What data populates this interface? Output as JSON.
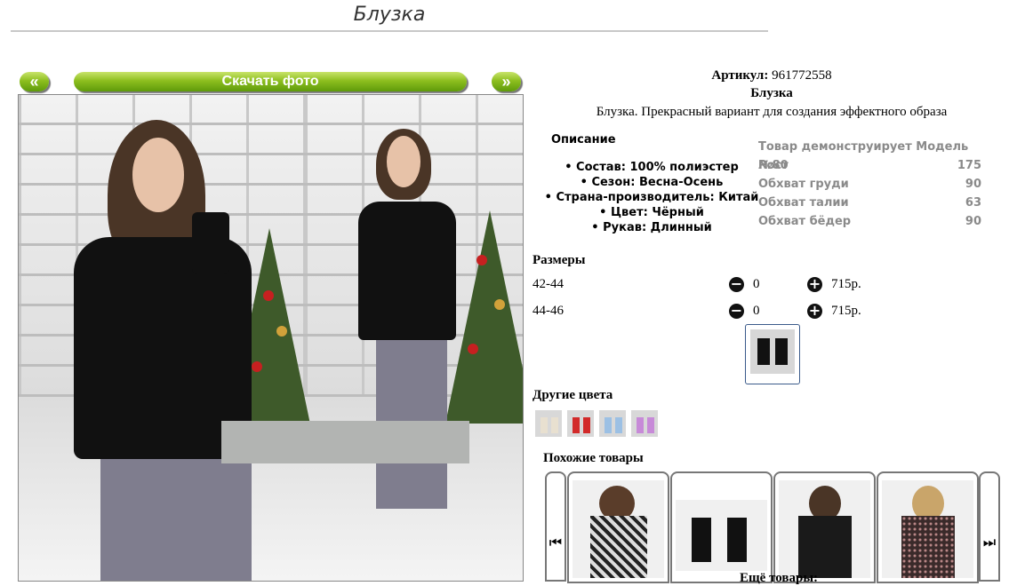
{
  "page": {
    "title": "Блузка"
  },
  "gallery": {
    "prev_label": "«",
    "download_label": "Скачать фото",
    "next_label": "»"
  },
  "product": {
    "artikul_label": "Артикул:",
    "artikul_value": "961772558",
    "name": "Блузка",
    "description": "Блузка. Прекрасный вариант для создания эффектного образа"
  },
  "description": {
    "heading": "Описание",
    "items": [
      "Состав: 100% полиэстер",
      "Сезон: Весна-Осень",
      "Страна-производитель: Китай",
      "Цвет: Чёрный",
      "Рукав: Длинный"
    ]
  },
  "model": {
    "heading": "Товар демонструирует Модель №80",
    "rows": [
      {
        "label": "Рост",
        "value": "175"
      },
      {
        "label": "Обхват груди",
        "value": "90"
      },
      {
        "label": "Обхват талии",
        "value": "63"
      },
      {
        "label": "Обхват бёдер",
        "value": "90"
      }
    ]
  },
  "sizes": {
    "heading": "Размеры",
    "rows": [
      {
        "size": "42-44",
        "qty": "0",
        "price": "715р."
      },
      {
        "size": "44-46",
        "qty": "0",
        "price": "715р."
      }
    ]
  },
  "colors": {
    "heading": "Другие цвета"
  },
  "similar": {
    "heading": "Похожие товары",
    "left_arrow": "⏮",
    "right_arrow": "⏭",
    "more": "Ещё товары:"
  },
  "icons": {
    "minus": "minus-circle-icon",
    "plus": "plus-circle-icon"
  },
  "accent_colors": {
    "button_green": "#7fb51a",
    "thumb_border": "#3a5a8a"
  }
}
